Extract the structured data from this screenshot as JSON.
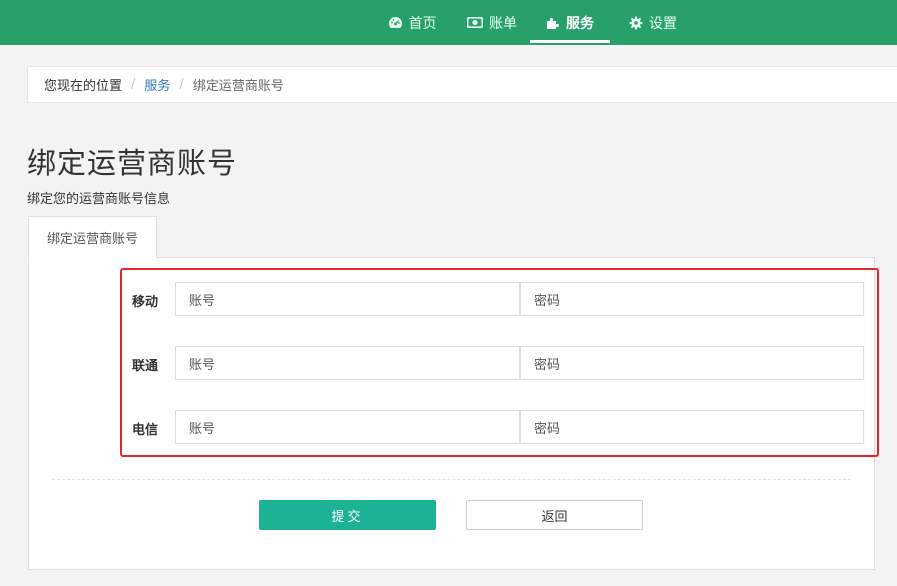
{
  "nav": {
    "items": [
      {
        "label": "首页",
        "icon": "dashboard-icon"
      },
      {
        "label": "账单",
        "icon": "money-icon"
      },
      {
        "label": "服务",
        "icon": "puzzle-icon"
      },
      {
        "label": "设置",
        "icon": "gear-icon"
      }
    ],
    "active": "服务"
  },
  "breadcrumb": {
    "prefix": "您现在的位置",
    "link": "服务",
    "current": "绑定运营商账号"
  },
  "page": {
    "title": "绑定运营商账号",
    "subtitle": "绑定您的运营商账号信息"
  },
  "tab": {
    "label": "绑定运营商账号"
  },
  "form": {
    "account_addon": "账号",
    "password_addon": "密码",
    "carriers": [
      {
        "name": "移动",
        "account_value": "",
        "password_value": ""
      },
      {
        "name": "联通",
        "account_value": "",
        "password_value": ""
      },
      {
        "name": "电信",
        "account_value": "",
        "password_value": ""
      }
    ]
  },
  "buttons": {
    "submit": "提交",
    "back": "返回"
  },
  "colors": {
    "topbar": "#27a069",
    "submit": "#1bb394",
    "highlight": "#e3272b",
    "link": "#2f79b8"
  }
}
